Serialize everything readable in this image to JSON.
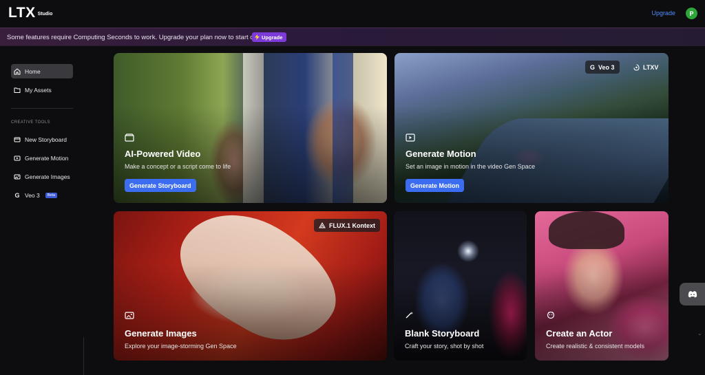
{
  "header": {
    "logo": "LTX",
    "logo_sub": "Studio",
    "upgrade_label": "Upgrade",
    "avatar_initial": "P"
  },
  "banner": {
    "text": "Some features require Computing Seconds to work. Upgrade your plan now to start creating.",
    "button_label": "Upgrade"
  },
  "sidebar": {
    "home": "Home",
    "my_assets": "My Assets",
    "section_label": "CREATIVE TOOLS",
    "tools": [
      {
        "label": "New Storyboard",
        "icon": "storyboard-icon"
      },
      {
        "label": "Generate Motion",
        "icon": "motion-icon"
      },
      {
        "label": "Generate Images",
        "icon": "images-icon"
      },
      {
        "label": "Veo 3",
        "icon": "google-icon",
        "badge": "Beta"
      }
    ]
  },
  "cards": {
    "video": {
      "title": "AI-Powered Video",
      "desc": "Make a concept or a script come to life",
      "button": "Generate Storyboard"
    },
    "motion": {
      "title": "Generate Motion",
      "desc": "Set an image in motion in the video Gen Space",
      "button": "Generate Motion",
      "tags": [
        "Veo 3",
        "LTXV"
      ]
    },
    "images": {
      "title": "Generate Images",
      "desc": "Explore your image-storming Gen Space",
      "tag": "FLUX.1 Kontext"
    },
    "blank": {
      "title": "Blank Storyboard",
      "desc": "Craft your story, shot by shot"
    },
    "actor": {
      "title": "Create an Actor",
      "desc": "Create realistic & consistent models"
    }
  },
  "colors": {
    "accent_blue": "#3c6cf0",
    "link_blue": "#4e8cff",
    "upgrade_purple": "#7c3bd8",
    "avatar_green": "#2ea43a"
  }
}
